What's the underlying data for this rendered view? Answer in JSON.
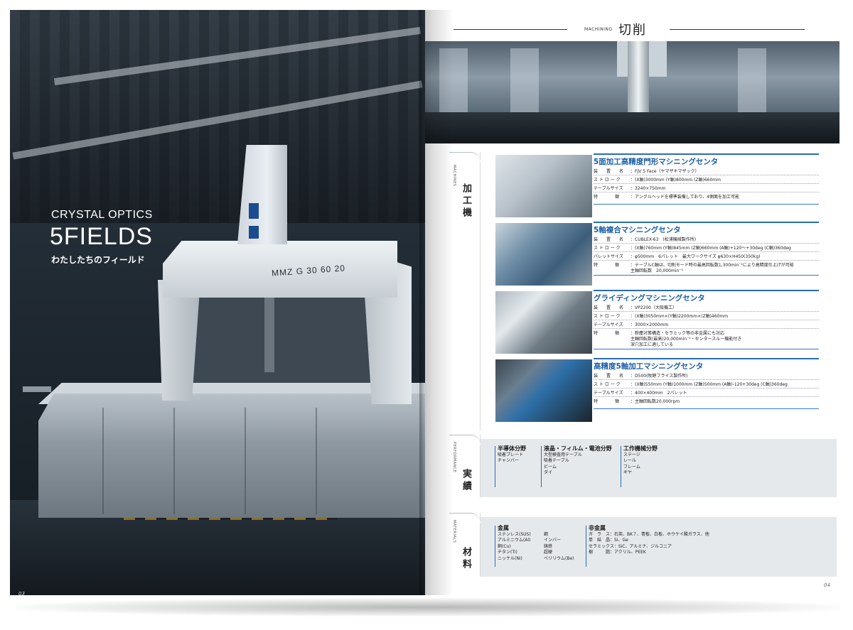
{
  "left_page": {
    "subtitle": "CRYSTAL OPTICS",
    "title": "5FIELDS",
    "tagline": "わたしたちのフィールド",
    "machine_label": "MMZ G 30 60 20",
    "page_number": "03"
  },
  "right_page": {
    "header_en": "MACHINING",
    "header_jp": "切削",
    "page_number": "04",
    "sections": {
      "machines": {
        "en": "MACHINES",
        "jp": "加工機"
      },
      "performance": {
        "en": "PERFORMANCE",
        "jp": "実績"
      },
      "materials": {
        "en": "MATERIALS",
        "jp": "材料"
      }
    },
    "machines": [
      {
        "title": "5面加工高精度門形マシニングセンタ",
        "specs": [
          {
            "k": "装　　置　　名",
            "v": "：FJV 5 Face（ヤマザキマザック）"
          },
          {
            "k": "ス ト ロ ー ク",
            "v": "：(X軸)3000mm (Y軸)800mm (Z軸)660mm"
          },
          {
            "k": "テーブルサイズ",
            "v": "：3240×750mm"
          },
          {
            "k": "特　　　　徴",
            "v": "：アングルヘッドを標準装備しており、4側面を加工可能"
          }
        ]
      },
      {
        "title": "5軸複合マシニングセンタ",
        "specs": [
          {
            "k": "装　　置　　名",
            "v": "：CUBLEX-63　(松浦機械製作所)"
          },
          {
            "k": "ス ト ロ ー ク",
            "v": "：(X軸)760mm (Y軸)845mm (Z軸)660mm (A軸)+120〜+30deg (C軸)360deg"
          },
          {
            "k": "パレットサイズ",
            "v": "：φ500mm　6パレット　最大ワークサイズ φ630×H450(350kg)"
          },
          {
            "k": "特　　　　徴",
            "v": "：テーブルC軸は、切削モード時の最高回転数1,300min⁻¹により高精度仕上げが可能",
            "v2": "主軸回転数　20,000min⁻¹"
          }
        ]
      },
      {
        "title": "グライディングマシニングセンタ",
        "specs": [
          {
            "k": "装　　置　　名",
            "v": "：VP2200（大阪機工）"
          },
          {
            "k": "ス ト ロ ー ク",
            "v": "：(X軸)3050mm×(Y軸)2200mm×(Z軸)460mm"
          },
          {
            "k": "テーブルサイズ",
            "v": "：3000×2000mm"
          },
          {
            "k": "特　　　　徴",
            "v": "：粉塵対策構造・セラミック等の非金属にも対応",
            "v2": "主軸回転数(最高)20,000min⁻¹・センタースルー機能付き",
            "v3": "深穴加工に適している"
          }
        ]
      },
      {
        "title": "高精度5軸加工マシニングセンタ",
        "specs": [
          {
            "k": "装　　置　　名",
            "v": "：D500(牧野フライス製作所)"
          },
          {
            "k": "ス ト ロ ー ク",
            "v": "：(X軸)550mm (Y軸)1000mm (Z軸)500mm (A軸)-120+30deg (C軸)360deg"
          },
          {
            "k": "テーブルサイズ",
            "v": "：400×400mm　2パレット"
          },
          {
            "k": "特　　　　徴",
            "v": "：主軸回転数20,000rpm"
          }
        ]
      }
    ],
    "performance": [
      {
        "heading": "半導体分野",
        "items": [
          "吸着プレート",
          "チャンバー"
        ]
      },
      {
        "heading": "液晶・フィルム・電池分野",
        "items": [
          "大型検査用テーブル",
          "吸着テーブル",
          "ビーム",
          "ダイ"
        ]
      },
      {
        "heading": "工作機械分野",
        "items": [
          "ステージ",
          "レール",
          "フレーム",
          "ギヤ"
        ]
      }
    ],
    "materials": {
      "metal_heading": "金属",
      "metal_col1": [
        "ステンレス(SUS)",
        "アルミニウム(Al)",
        "銅(Cu)",
        "チタン(Ti)",
        "ニッケル(Ni)"
      ],
      "metal_col2": [
        "鋼",
        "インバー",
        "鋳鉄",
        "超硬",
        "ベリリウム(Be)"
      ],
      "nonmetal_heading": "非金属",
      "nonmetal": [
        "ガ　ラ　ス：石英、BK７、青板、白板、ホウケイ酸ガラス、他",
        "単　結　晶：Si、Ge",
        "セラミックス：SiC、アルミナ、ジルコニア",
        "樹　　　脂：アクリル、PEEK"
      ]
    }
  }
}
